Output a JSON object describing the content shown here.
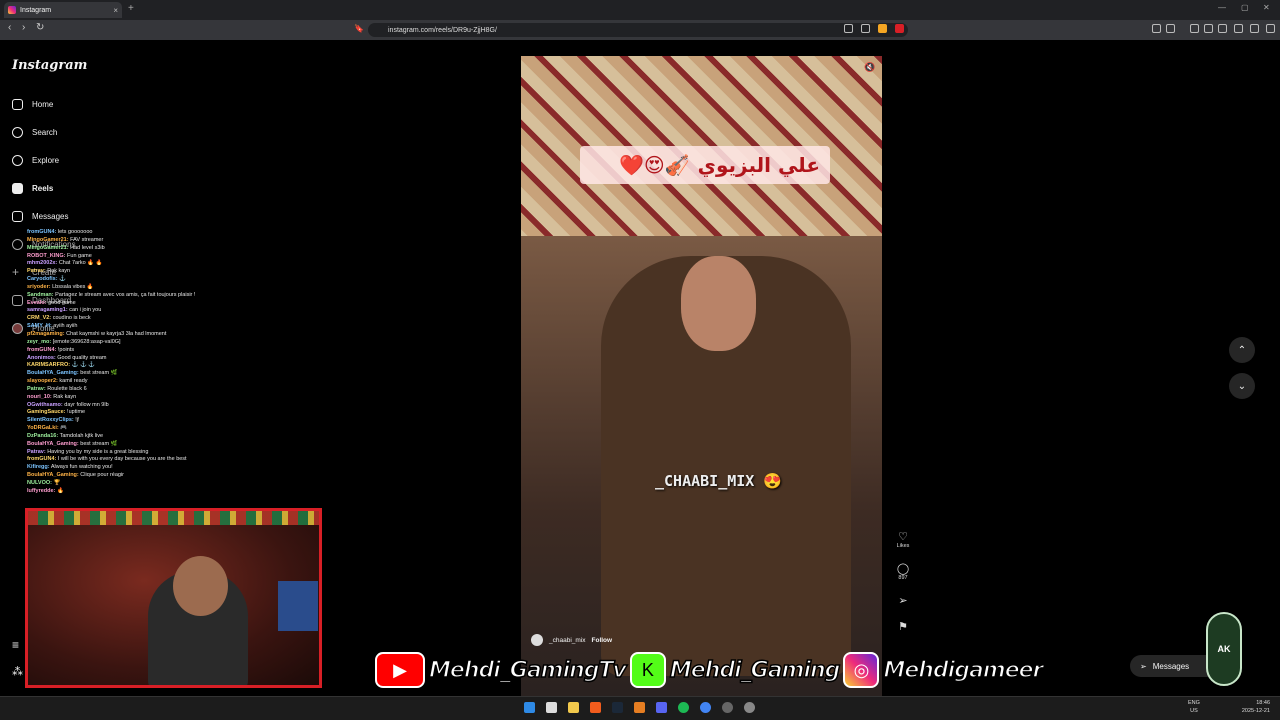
{
  "browser": {
    "tab_title": "Instagram",
    "url": "instagram.com/reels/DR9u-ZjjH8G/",
    "new_tab": "+",
    "close_tab": "×",
    "window_buttons": [
      "—",
      "▢",
      "✕"
    ]
  },
  "sidebar": {
    "logo": "Instagram",
    "items": [
      {
        "label": "Home",
        "icon": "home-icon"
      },
      {
        "label": "Search",
        "icon": "search-icon"
      },
      {
        "label": "Explore",
        "icon": "compass-icon"
      },
      {
        "label": "Reels",
        "icon": "reels-icon"
      },
      {
        "label": "Messages",
        "icon": "send-icon"
      },
      {
        "label": "Notifications",
        "icon": "heart-icon"
      },
      {
        "label": "Create",
        "icon": "plus-icon"
      },
      {
        "label": "Dashboard",
        "icon": "chart-icon"
      },
      {
        "label": "Profile",
        "icon": "avatar-icon"
      }
    ]
  },
  "chat": [
    {
      "user": "fromGUN4:",
      "msg": "lets gooooooo"
    },
    {
      "user": "MingoGamer21:",
      "msg": "FAV streamer"
    },
    {
      "user": "MingoGamer21:",
      "msg": "Had level s3ib"
    },
    {
      "user": "ROBOT_KING:",
      "msg": "Fun game"
    },
    {
      "user": "mhm2002x:",
      "msg": "Chat 7arko 🔥 🔥"
    },
    {
      "user": "Patrav:",
      "msg": "Rak kayn"
    },
    {
      "user": "Caryodofis:",
      "msg": "⚓"
    },
    {
      "user": "sriyoder:",
      "msg": "Lbssala vibes 🔥"
    },
    {
      "user": "Sandman:",
      "msg": "Partagez le stream avec vos amis, ça fait toujours plaisir !"
    },
    {
      "user": "Evealo:",
      "msg": "good game"
    },
    {
      "user": "samragaming1:",
      "msg": "can i join you"
    },
    {
      "user": "CRM_V2:",
      "msg": "coudino is beck"
    },
    {
      "user": "SAMY_H:",
      "msg": "ayiih ayiih"
    },
    {
      "user": "pf2magaming:",
      "msg": "Chat kaymshi w kayrja3 3la had lmoment"
    },
    {
      "user": "zeyr_mo:",
      "msg": "[emote:369628:asap-val0G]"
    },
    {
      "user": "fromGUN4:",
      "msg": "!points"
    },
    {
      "user": "Anonimos:",
      "msg": "Good quality stream"
    },
    {
      "user": "KARIMSARFRO:",
      "msg": "⚓ ⚓ ⚓"
    },
    {
      "user": "BoulaHYA_Gaming:",
      "msg": "best stream 🌿"
    },
    {
      "user": "slayooper2:",
      "msg": "kamil ready"
    },
    {
      "user": "Patrav:",
      "msg": "Roulette black 6"
    },
    {
      "user": "nouri_10:",
      "msg": "Rak kayn"
    },
    {
      "user": "OGwithsamo:",
      "msg": "dayr follow mn 9lb"
    },
    {
      "user": "GamingSauce:",
      "msg": "!uptime"
    },
    {
      "user": "SilentRoxxyClips:",
      "msg": "!j!"
    },
    {
      "user": "YoDRGaLki:",
      "msg": "🎮"
    },
    {
      "user": "DzPanda16:",
      "msg": "Tamdolah kjtk live"
    },
    {
      "user": "BoulaHYA_Gaming:",
      "msg": "best stream 🌿"
    },
    {
      "user": "Patrav:",
      "msg": "Having you by my side is a great blessing"
    },
    {
      "user": "fromGUN4:",
      "msg": "I will be with you every day because you are the best"
    },
    {
      "user": "Kifiregg:",
      "msg": "Always fun watching you!"
    },
    {
      "user": "BoulaHYA_Gaming:",
      "msg": "Clique pour réagir"
    },
    {
      "user": "NULVOO:",
      "msg": "🏆"
    },
    {
      "user": "luffyredde:",
      "msg": "🔥"
    }
  ],
  "reel": {
    "caption_arabic": "علي البزيوي",
    "caption_emoji": "❤️😍🎻",
    "watermark": "_CHAABI_MIX 😍",
    "author": "_chaabi_mix",
    "follow": "Follow",
    "likes_label": "Likes",
    "comments_count": "897"
  },
  "messages_button": "Messages",
  "banner": {
    "youtube": "Mehdi_GamingTv",
    "kick": "Mehdi_Gaming",
    "instagram": "Mehdigameer"
  },
  "ak_logo": "AK",
  "taskbar": {
    "lang_top": "ENG",
    "lang_bottom": "US",
    "time": "18:46",
    "date": "2025-12-21"
  },
  "colors": {
    "accent_red": "#d81f26",
    "youtube_red": "#ff0000",
    "kick_green": "#53fc18"
  }
}
